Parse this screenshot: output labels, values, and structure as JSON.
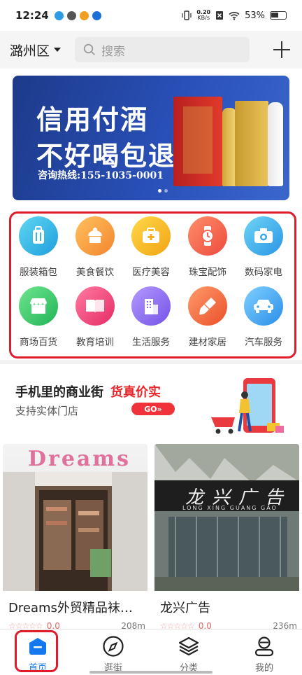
{
  "status_bar": {
    "time": "12:24",
    "speed_value": "0.20",
    "speed_unit": "KB/s",
    "battery": "53%"
  },
  "header": {
    "district": "潞州区",
    "search_placeholder": "搜索"
  },
  "banner": {
    "line1": "信用付酒",
    "line2": "不好喝包退",
    "hotline": "咨询热线:155-1035-0001"
  },
  "categories": [
    {
      "label": "服装箱包",
      "icon": "luggage-icon",
      "color": "#2fb9e8"
    },
    {
      "label": "美食餐饮",
      "icon": "cake-icon",
      "color": "#f6a13a"
    },
    {
      "label": "医疗美容",
      "icon": "medical-kit-icon",
      "color": "#f6b81f"
    },
    {
      "label": "珠宝配饰",
      "icon": "watch-icon",
      "color": "#f26a4e"
    },
    {
      "label": "数码家电",
      "icon": "camera-icon",
      "color": "#36b3e8"
    },
    {
      "label": "商场百货",
      "icon": "store-icon",
      "color": "#3fcc6a"
    },
    {
      "label": "教育培训",
      "icon": "book-icon",
      "color": "#f0467a"
    },
    {
      "label": "生活服务",
      "icon": "building-icon",
      "color": "#8e6cf0"
    },
    {
      "label": "建材家居",
      "icon": "brush-icon",
      "color": "#f36a3c"
    },
    {
      "label": "汽车服务",
      "icon": "car-icon",
      "color": "#3aa8f0"
    }
  ],
  "promo": {
    "title": "手机里的商业街",
    "highlight": "货真价实",
    "subtitle": "支持实体门店",
    "go_label": "GO»"
  },
  "shops": [
    {
      "name": "Dreams外贸精品袜…",
      "stars": "☆☆☆☆☆",
      "score": "0.0",
      "distance": "208m",
      "sign": "Dreams"
    },
    {
      "name": "龙兴广告",
      "stars": "☆☆☆☆☆",
      "score": "0.0",
      "distance": "236m",
      "sign": "龙兴广告",
      "sign_sub": "LONG XING GUANG GAO"
    }
  ],
  "tabs": [
    {
      "label": "首页",
      "icon": "home-icon",
      "active": true
    },
    {
      "label": "逛街",
      "icon": "compass-icon",
      "active": false
    },
    {
      "label": "分类",
      "icon": "layers-icon",
      "active": false
    },
    {
      "label": "我的",
      "icon": "user-icon",
      "active": false
    }
  ],
  "colors": {
    "accent": "#1478ef",
    "highlight_red": "#e8262c",
    "annotation_red": "#e01b2b"
  }
}
